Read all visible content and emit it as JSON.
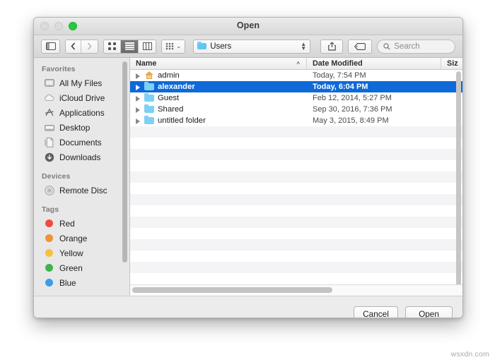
{
  "window": {
    "title": "Open",
    "traffic_lights": [
      "close-disabled",
      "minimize-disabled",
      "zoom-green"
    ]
  },
  "toolbar": {
    "sidebar_toggle_icon": "sidebar-toggle-icon",
    "back_icon": "chevron-left-icon",
    "forward_icon": "chevron-right-icon",
    "view_modes": [
      {
        "name": "icon-view",
        "icon": "grid-icon",
        "active": false
      },
      {
        "name": "list-view",
        "icon": "list-icon",
        "active": true
      },
      {
        "name": "column-view",
        "icon": "columns-icon",
        "active": false
      }
    ],
    "arrange_icon": "arrange-grid-icon",
    "arrange_caret": "⌄",
    "path_popup": {
      "label": "Users",
      "icon": "folder-users-icon",
      "stepper": "updown-arrows-icon"
    },
    "share_icon": "share-icon",
    "tag_icon": "tag-icon",
    "search": {
      "icon": "search-icon",
      "placeholder": "Search",
      "value": ""
    }
  },
  "sidebar": {
    "sections": [
      {
        "heading": "Favorites",
        "items": [
          {
            "label": "All My Files",
            "icon": "all-my-files-icon"
          },
          {
            "label": "iCloud Drive",
            "icon": "icloud-icon"
          },
          {
            "label": "Applications",
            "icon": "applications-icon"
          },
          {
            "label": "Desktop",
            "icon": "desktop-icon"
          },
          {
            "label": "Documents",
            "icon": "documents-icon"
          },
          {
            "label": "Downloads",
            "icon": "downloads-icon"
          }
        ]
      },
      {
        "heading": "Devices",
        "items": [
          {
            "label": "Remote Disc",
            "icon": "remote-disc-icon"
          }
        ]
      },
      {
        "heading": "Tags",
        "items": [
          {
            "label": "Red",
            "icon": "tag-dot-icon",
            "color": "#ef4b43"
          },
          {
            "label": "Orange",
            "icon": "tag-dot-icon",
            "color": "#f09236"
          },
          {
            "label": "Yellow",
            "icon": "tag-dot-icon",
            "color": "#f2c33c"
          },
          {
            "label": "Green",
            "icon": "tag-dot-icon",
            "color": "#3eb44a"
          },
          {
            "label": "Blue",
            "icon": "tag-dot-icon",
            "color": "#3b9ee5"
          }
        ]
      }
    ]
  },
  "file_list": {
    "columns": [
      {
        "label": "Name",
        "sort_caret": "^",
        "sorted": true
      },
      {
        "label": "Date Modified",
        "sorted": false
      },
      {
        "label": "Siz",
        "sorted": false
      }
    ],
    "rows": [
      {
        "name": "admin",
        "icon": "home-folder-icon",
        "date": "Today, 7:54 PM",
        "size": "--",
        "selected": false,
        "expander": "disclosure-triangle-icon"
      },
      {
        "name": "alexander",
        "icon": "folder-icon",
        "date": "Today, 6:04 PM",
        "size": "--",
        "selected": true,
        "expander": "disclosure-triangle-icon"
      },
      {
        "name": "Guest",
        "icon": "folder-icon",
        "date": "Feb 12, 2014, 5:27 PM",
        "size": "--",
        "selected": false,
        "expander": "disclosure-triangle-icon"
      },
      {
        "name": "Shared",
        "icon": "folder-icon",
        "date": "Sep 30, 2016, 7:36 PM",
        "size": "--",
        "selected": false,
        "expander": "disclosure-triangle-icon"
      },
      {
        "name": "untitled folder",
        "icon": "folder-icon",
        "date": "May 3, 2015, 8:49 PM",
        "size": "--",
        "selected": false,
        "expander": "disclosure-triangle-icon"
      }
    ]
  },
  "footer": {
    "cancel_label": "Cancel",
    "open_label": "Open"
  },
  "watermark": "wsxdn.com",
  "colors": {
    "selection_blue": "#0d6ad8",
    "window_chrome": "#ececec",
    "sidebar_bg": "#e8e8e8",
    "folder_blue": "#7fd0f5",
    "zoom_green": "#28c940"
  }
}
